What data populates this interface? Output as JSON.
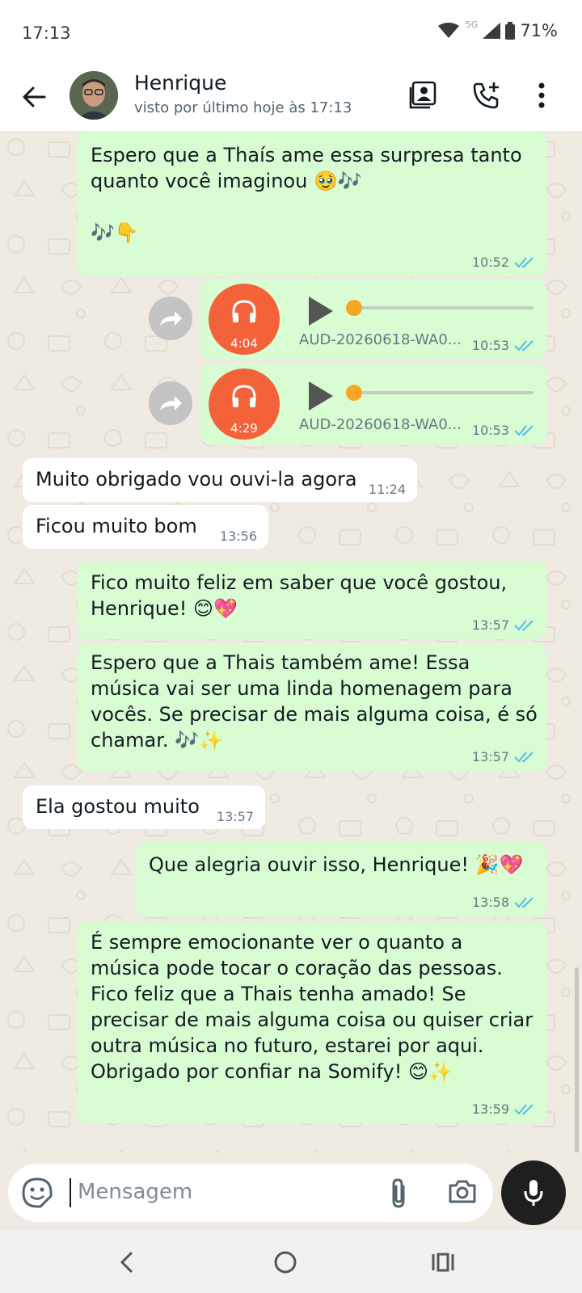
{
  "status_bar": {
    "time": "17:13",
    "network": "5G",
    "battery": "71%"
  },
  "header": {
    "contact_name": "Henrique",
    "last_seen": "visto por último hoje às 17:13",
    "icons": [
      "back-arrow-icon",
      "contact-card-icon",
      "add-call-icon",
      "more-vert-icon"
    ]
  },
  "messages": [
    {
      "dir": "out",
      "text": "Espero que a Thaís ame essa surpresa tanto\nquanto você imaginou 🥹🎶\n\n🎶👇",
      "time": "10:52",
      "status": "read"
    },
    {
      "dir": "out",
      "type": "audio",
      "duration": "4:04",
      "filename": "AUD-20260618-WA0...",
      "time": "10:53",
      "status": "read"
    },
    {
      "dir": "out",
      "type": "audio",
      "duration": "4:29",
      "filename": "AUD-20260618-WA0...",
      "time": "10:53",
      "status": "read"
    },
    {
      "dir": "in",
      "text": "Muito obrigado vou ouvi-la agora",
      "time": "11:24"
    },
    {
      "dir": "in",
      "text": "Ficou muito bom",
      "time": "13:56"
    },
    {
      "dir": "out",
      "text": "Fico muito feliz em saber que você gostou,\nHenrique! 😊💖",
      "time": "13:57",
      "status": "read"
    },
    {
      "dir": "out",
      "text": "Espero que a Thais também ame! Essa\nmúsica vai ser uma linda homenagem para\nvocês. Se precisar de mais alguma coisa, é só\nchamar. 🎶✨",
      "time": "13:57",
      "status": "read"
    },
    {
      "dir": "in",
      "text": "Ela gostou muito",
      "time": "13:57"
    },
    {
      "dir": "out",
      "text": "Que alegria ouvir isso, Henrique! 🎉💖",
      "time": "13:58",
      "status": "read"
    },
    {
      "dir": "out",
      "text": "É sempre emocionante ver o quanto a\nmúsica pode tocar o coração das pessoas.\nFico feliz que a Thais tenha amado! Se\nprecisar de mais alguma coisa ou quiser criar\noutra música no futuro, estarei por aqui.\nObrigado por confiar na Somify! 😊✨",
      "time": "13:59",
      "status": "read"
    }
  ],
  "composer": {
    "placeholder": "Mensagem"
  },
  "colors": {
    "outgoing_bubble": "#d9fdd3",
    "incoming_bubble": "#ffffff",
    "read_tick": "#53bdeb",
    "audio_head": "#f4623a"
  }
}
